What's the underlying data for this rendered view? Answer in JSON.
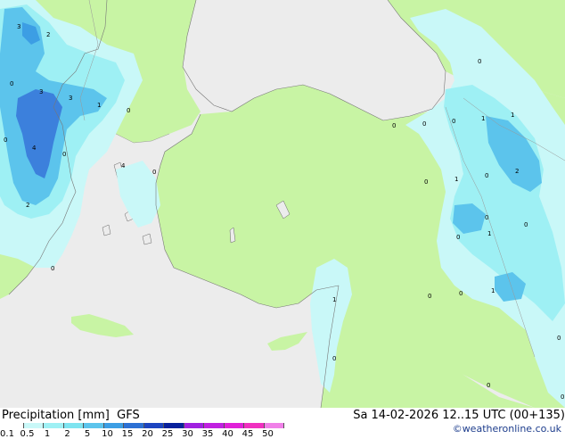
{
  "map": {
    "value_labels": [
      "3",
      "2",
      "3",
      "3",
      "4",
      "1",
      "0",
      "0",
      "0",
      "0",
      "4",
      "0",
      "2",
      "0",
      "0",
      "0",
      "0",
      "0",
      "0",
      "0",
      "1",
      "1",
      "2",
      "0",
      "1",
      "0",
      "0",
      "1",
      "0",
      "1",
      "0",
      "0",
      "1",
      "0",
      "0",
      "0"
    ]
  },
  "footer": {
    "title": "Precipitation [mm]  GFS",
    "datetime": "Sa 14-02-2026 12..15 UTC (00+135)",
    "credit": "©weatheronline.co.uk"
  },
  "legend": {
    "labels": [
      "0.1",
      "0.5",
      "1",
      "2",
      "5",
      "10",
      "15",
      "20",
      "25",
      "30",
      "35",
      "40",
      "45",
      "50"
    ],
    "colors": [
      "#ffffff",
      "#c9f8f8",
      "#9ef0f4",
      "#7ee4f0",
      "#5cc4ec",
      "#3c9ee4",
      "#2c70d4",
      "#1c44c0",
      "#08209c",
      "#a020e0",
      "#c020e0",
      "#e020d8",
      "#f030c0",
      "#f080e8"
    ]
  },
  "colors": {
    "sea": "#ececec",
    "land": "#c8f4a4",
    "precip_light": "#c9f8f8",
    "precip_mid": "#9ef0f4",
    "precip_heavy": "#5cc4ec",
    "precip_max": "#3c80dc"
  }
}
